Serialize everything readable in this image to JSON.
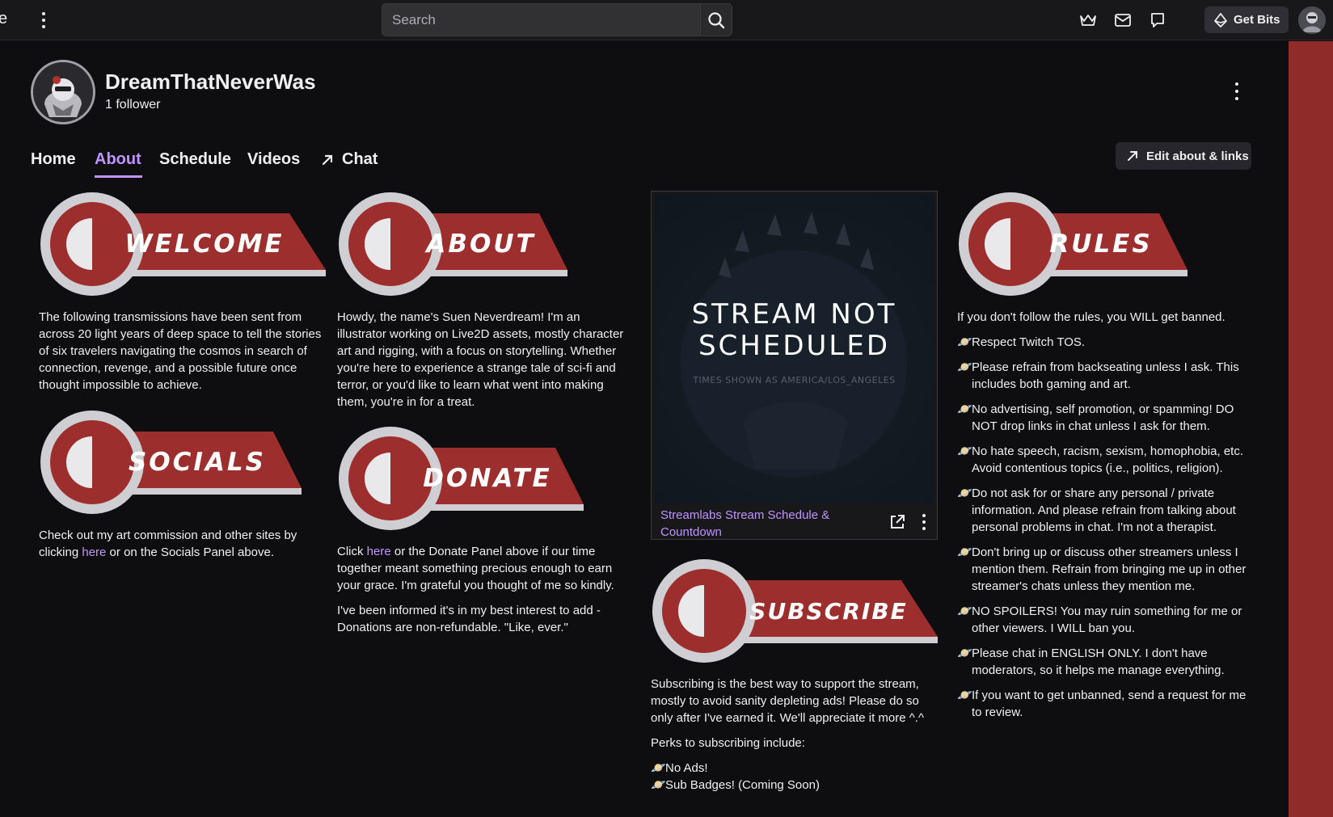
{
  "topbar": {
    "left_fragment": "e",
    "search_placeholder": "Search",
    "get_bits_label": "Get Bits",
    "icons": [
      "kebab-icon",
      "search-icon",
      "crown-icon",
      "inbox-icon",
      "whisper-icon",
      "bits-diamond-icon"
    ]
  },
  "profile": {
    "name": "DreamThatNeverWas",
    "followers": "1 follower"
  },
  "tabs": [
    {
      "label": "Home"
    },
    {
      "label": "About"
    },
    {
      "label": "Schedule"
    },
    {
      "label": "Videos"
    },
    {
      "label": "Chat"
    }
  ],
  "active_tab": "About",
  "edit_button": "Edit about & links",
  "colors": {
    "accent": "#bf94ff",
    "banner_red": "#9c2f2d",
    "right_strip": "#8f2c2a",
    "background": "#0e0e10"
  },
  "panels": {
    "welcome": {
      "banner": "WELCOME",
      "text": "The following transmissions have been sent from across 20 light years of deep space to tell the stories of six travelers navigating the cosmos in search of connection, revenge, and a possible future once thought impossible to achieve."
    },
    "socials": {
      "banner": "SOCIALS",
      "text_before": "Check out my art commission and other sites by clicking ",
      "link": "here",
      "text_after": " or on the Socials Panel above."
    },
    "about": {
      "banner": "ABOUT",
      "text": "Howdy, the name's Suen Neverdream! I'm an illustrator working on Live2D assets, mostly character art and rigging, with a focus on storytelling. Whether you're here to experience a strange tale of sci-fi and terror, or you'd like to learn what went into making them, you're in for a treat."
    },
    "donate": {
      "banner": "DONATE",
      "p1_before": "Click ",
      "p1_link": "here",
      "p1_after": " or the Donate Panel above if our time together meant something precious enough to earn your grace. I'm grateful you thought of me so kindly.",
      "p2": "I've been informed it's in my best interest to add - Donations are non-refundable. \"Like, ever.\""
    },
    "schedule": {
      "title": "STREAM NOT SCHEDULED",
      "subtitle": "TIMES SHOWN AS AMERICA/LOS_ANGELES",
      "link": "Streamlabs Stream Schedule & Countdown"
    },
    "subscribe": {
      "banner": "SUBSCRIBE",
      "p1": "Subscribing is the best way to support the stream, mostly to avoid sanity depleting ads! Please do so only after I've earned it. We'll appreciate it more ^.^",
      "p2": "Perks to subscribing include:",
      "perks": [
        "No Ads!",
        "Sub Badges! (Coming Soon)"
      ]
    },
    "rules": {
      "banner": "RULES",
      "intro": "If you don't follow the rules, you WILL get banned.",
      "items": [
        "Respect Twitch TOS.",
        "Please refrain from backseating unless I ask. This includes both gaming and art.",
        "No advertising, self promotion, or spamming! DO NOT drop links in chat unless I ask for them.",
        "No hate speech, racism, sexism, homophobia, etc. Avoid contentious topics (i.e., politics, religion).",
        "Do not ask for or share any personal / private information. And please refrain from talking about personal problems in chat. I'm not a therapist.",
        "Don't bring up or discuss other streamers unless I mention them. Refrain from bringing me up in other streamer's chats unless they mention me.",
        "NO SPOILERS! You may ruin something for me or other viewers. I WILL ban you.",
        "Please chat in ENGLISH ONLY. I don't have moderators, so it helps me manage everything.",
        "If you want to get unbanned, send a request for me to review."
      ]
    }
  }
}
